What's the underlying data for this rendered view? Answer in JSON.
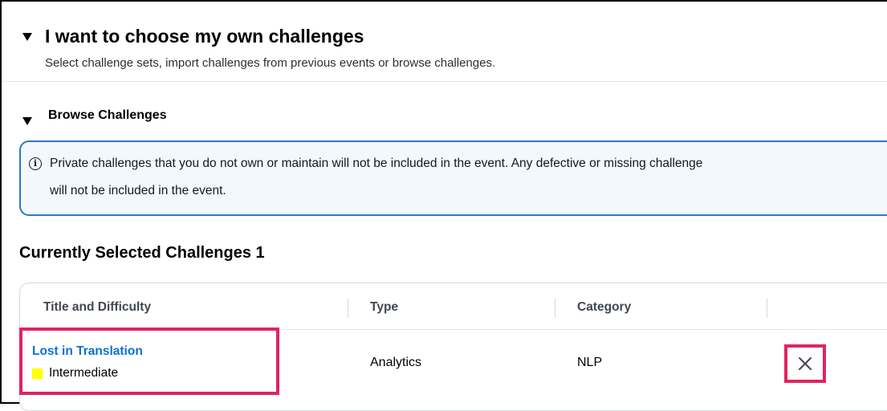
{
  "expander": {
    "title": "I want to choose my own challenges",
    "description": "Select challenge sets, import challenges from previous events or browse challenges."
  },
  "browse": {
    "title": "Browse Challenges"
  },
  "info": {
    "line1": "Private challenges that you do not own or maintain will not be included in the event. Any defective or missing challenge",
    "line2": "will not be included in the event."
  },
  "selected": {
    "heading": "Currently Selected Challenges 1"
  },
  "table": {
    "headers": {
      "title": "Title and Difficulty",
      "type": "Type",
      "category": "Category"
    },
    "rows": [
      {
        "title": "Lost in Translation",
        "difficulty": "Intermediate",
        "difficulty_color": "#ffff00",
        "type": "Analytics",
        "category": "NLP",
        "remove_icon": "close-icon"
      }
    ]
  },
  "colors": {
    "link": "#0972d3",
    "info_border": "#2f78c4",
    "info_bg": "#f2f8fd",
    "highlight": "#e0245e"
  }
}
